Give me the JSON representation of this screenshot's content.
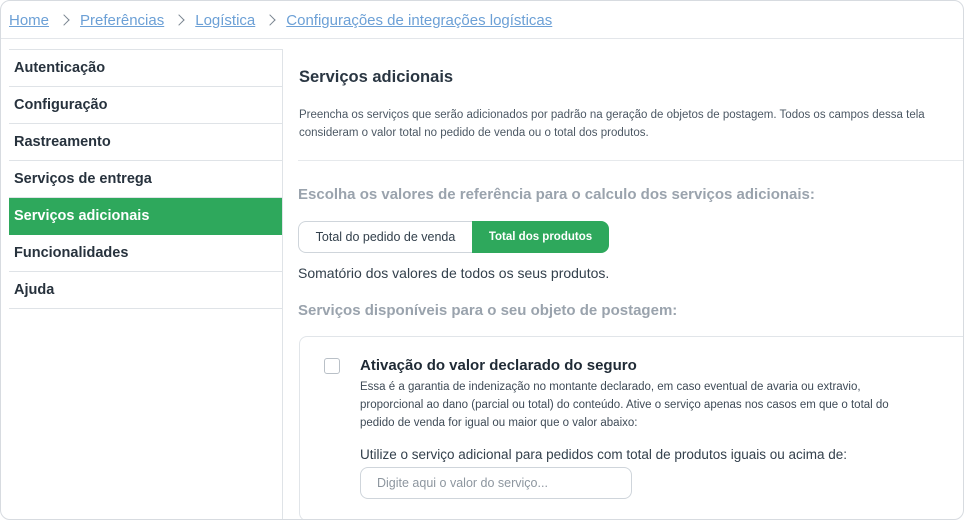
{
  "breadcrumb": {
    "items": [
      "Home",
      "Preferências",
      "Logística",
      "Configurações de integrações logísticas"
    ]
  },
  "sidebar": {
    "items": [
      {
        "label": "Autenticação"
      },
      {
        "label": "Configuração"
      },
      {
        "label": "Rastreamento"
      },
      {
        "label": "Serviços de entrega"
      },
      {
        "label": "Serviços adicionais"
      },
      {
        "label": "Funcionalidades"
      },
      {
        "label": "Ajuda"
      }
    ],
    "active_index": 4
  },
  "main": {
    "title": "Serviços adicionais",
    "description": "Preencha os serviços que serão adicionados por padrão na geração de objetos de postagem. Todos os campos dessa tela consideram o valor total no pedido de venda ou o total dos produtos.",
    "reference_heading": "Escolha os valores de referência para o calculo dos serviços adicionais:",
    "toggle": {
      "options": [
        "Total do pedido de venda",
        "Total dos produtos"
      ],
      "selected": "Total dos produtos",
      "selected_description": "Somatório dos valores de todos os seus produtos."
    },
    "services_heading": "Serviços disponíveis para o seu objeto de postagem:",
    "service_card": {
      "title": "Ativação do valor declarado do seguro",
      "description": "Essa é a garantia de indenização no montante declarado, em caso eventual de avaria ou extravio, proporcional ao dano (parcial ou total) do conteúdo. Ative o serviço apenas nos casos em que o total do pedido de venda for igual ou maior que o valor abaixo:",
      "checked": false,
      "input_label": "Utilize o serviço adicional para pedidos com total de produtos iguais ou acima de:",
      "input_placeholder": "Digite aqui o valor do serviço...",
      "input_value": ""
    }
  },
  "colors": {
    "accent_green": "#2ea85c",
    "link_blue": "#6ca0d6",
    "muted_heading": "#9aa3ad"
  },
  "icons": {
    "breadcrumb_separator": "chevron-right-icon",
    "checkbox": "checkbox-unchecked"
  }
}
